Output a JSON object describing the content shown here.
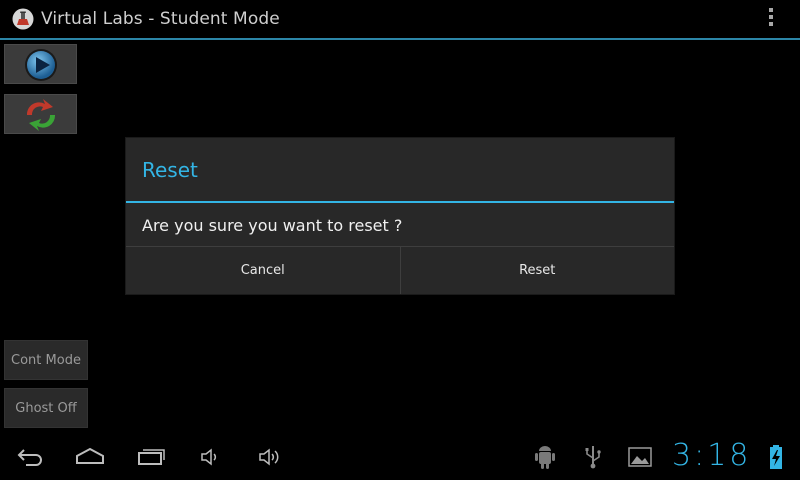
{
  "app": {
    "title": "Virtual Labs - Student Mode",
    "icon": "flask-icon"
  },
  "toolbar": {
    "play_icon": "play-icon",
    "reset_icon": "refresh-icon",
    "cont_mode_label": "Cont Mode",
    "ghost_label": "Ghost Off"
  },
  "dialog": {
    "title": "Reset",
    "message": "Are you sure you want to reset ?",
    "cancel_label": "Cancel",
    "confirm_label": "Reset"
  },
  "statusbar": {
    "time": "3:18"
  },
  "colors": {
    "accent": "#33b5e5",
    "background": "#000000",
    "dialog_bg": "#282828"
  }
}
